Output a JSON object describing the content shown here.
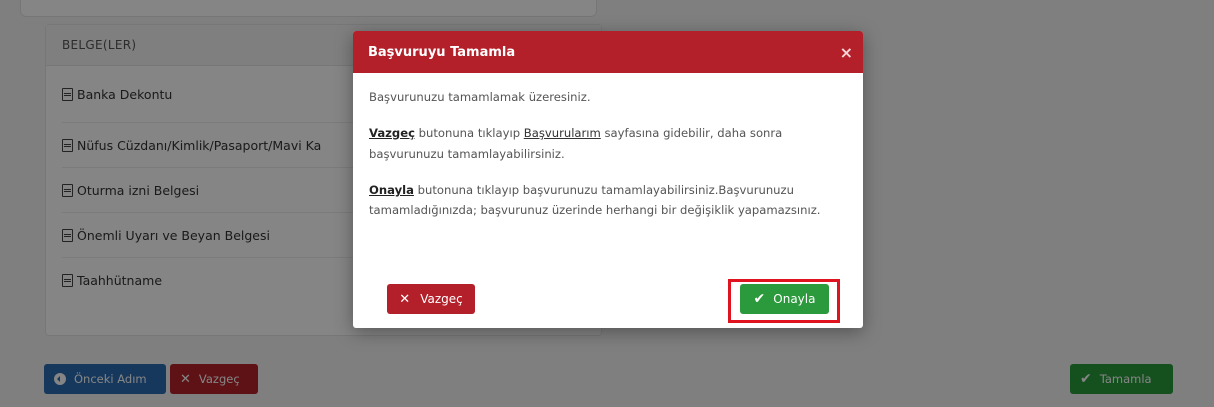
{
  "background": {
    "documents_panel": {
      "header": "BELGE(LER)",
      "items": [
        "Banka Dekontu",
        "Nüfus Cüzdanı/Kimlik/Pasaport/Mavi Ka",
        "Oturma izni Belgesi",
        "Önemli Uyarı ve Beyan Belgesi",
        "Taahhütname"
      ]
    },
    "footer": {
      "prev_label": "Önceki Adım",
      "cancel_label": "Vazgeç",
      "complete_label": "Tamamla"
    }
  },
  "modal": {
    "title": "Başvuruyu Tamamla",
    "close_glyph": "×",
    "p1": "Başvurunuzu tamamlamak üzeresiniz.",
    "p2_bold": "Vazgeç",
    "p2_a": " butonuna tıklayıp ",
    "p2_link": "Başvurularım",
    "p2_b": " sayfasına gidebilir, daha sonra başvurunuzu tamamlayabilirsiniz.",
    "p3_bold": "Onayla",
    "p3_rest": " butonuna tıklayıp başvurunuzu tamamlayabilirsiniz.Başvurunuzu tamamladığınızda; başvurunuz üzerinde herhangi bir değişiklik yapamazsınız.",
    "cancel_label": "Vazgeç",
    "confirm_label": "Onayla"
  },
  "colors": {
    "primary_red": "#b3202a",
    "success_green": "#2a9a3c",
    "primary_blue": "#2b6bb3",
    "highlight_red": "#e0141e"
  }
}
